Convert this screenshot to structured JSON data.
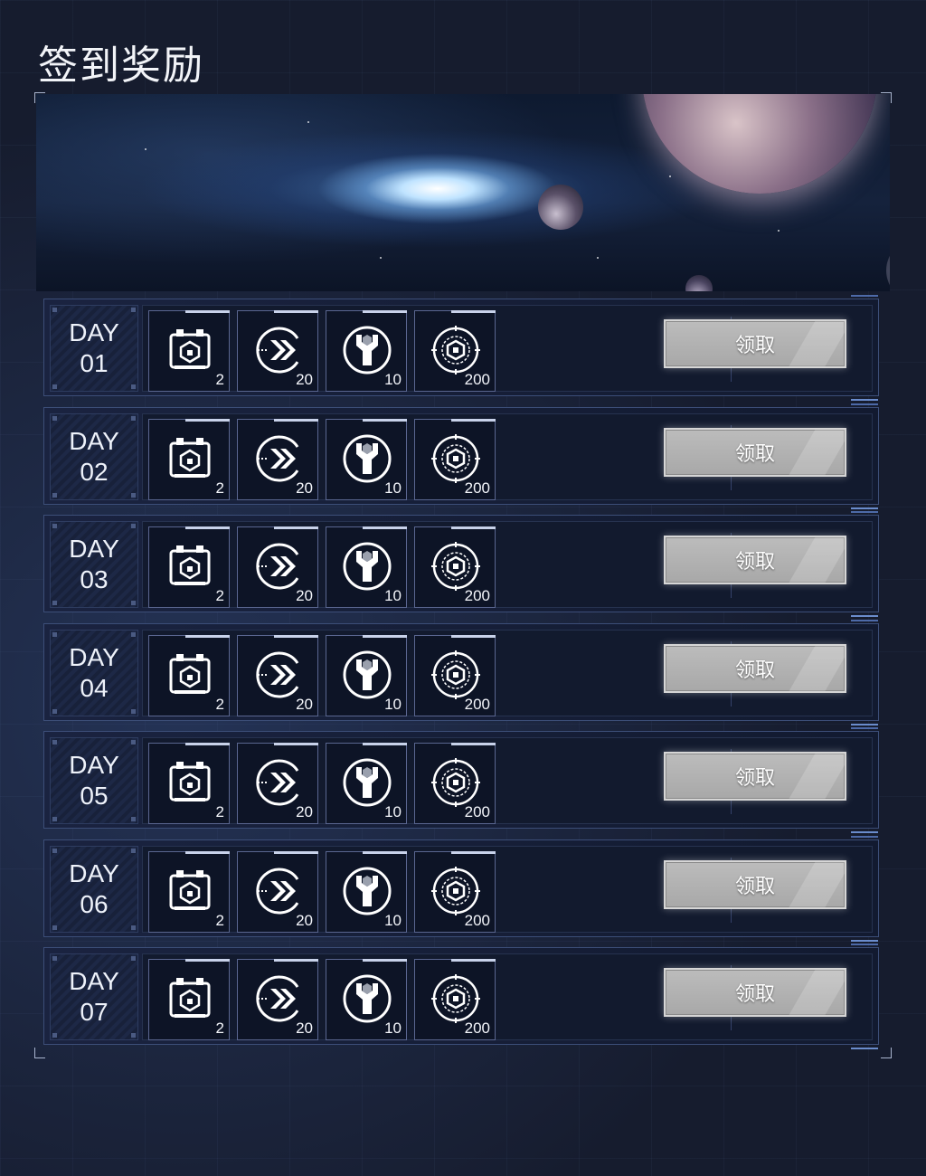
{
  "page": {
    "title": "签到奖励"
  },
  "colors": {
    "background": "#161c2e",
    "row_border": "#3c4e78",
    "button": "#b0b0b0",
    "accent": "#6a8ccc"
  },
  "rows": [
    {
      "day_label": "DAY",
      "day_num": "01",
      "items": [
        {
          "icon": "crate-icon",
          "qty": "2"
        },
        {
          "icon": "speed-arrows-icon",
          "qty": "20"
        },
        {
          "icon": "wrench-icon",
          "qty": "10"
        },
        {
          "icon": "cube-core-icon",
          "qty": "200"
        }
      ],
      "button": "领取"
    },
    {
      "day_label": "DAY",
      "day_num": "02",
      "items": [
        {
          "icon": "crate-icon",
          "qty": "2"
        },
        {
          "icon": "speed-arrows-icon",
          "qty": "20"
        },
        {
          "icon": "wrench-icon",
          "qty": "10"
        },
        {
          "icon": "cube-core-icon",
          "qty": "200"
        }
      ],
      "button": "领取"
    },
    {
      "day_label": "DAY",
      "day_num": "03",
      "items": [
        {
          "icon": "crate-icon",
          "qty": "2"
        },
        {
          "icon": "speed-arrows-icon",
          "qty": "20"
        },
        {
          "icon": "wrench-icon",
          "qty": "10"
        },
        {
          "icon": "cube-core-icon",
          "qty": "200"
        }
      ],
      "button": "领取"
    },
    {
      "day_label": "DAY",
      "day_num": "04",
      "items": [
        {
          "icon": "crate-icon",
          "qty": "2"
        },
        {
          "icon": "speed-arrows-icon",
          "qty": "20"
        },
        {
          "icon": "wrench-icon",
          "qty": "10"
        },
        {
          "icon": "cube-core-icon",
          "qty": "200"
        }
      ],
      "button": "领取"
    },
    {
      "day_label": "DAY",
      "day_num": "05",
      "items": [
        {
          "icon": "crate-icon",
          "qty": "2"
        },
        {
          "icon": "speed-arrows-icon",
          "qty": "20"
        },
        {
          "icon": "wrench-icon",
          "qty": "10"
        },
        {
          "icon": "cube-core-icon",
          "qty": "200"
        }
      ],
      "button": "领取"
    },
    {
      "day_label": "DAY",
      "day_num": "06",
      "items": [
        {
          "icon": "crate-icon",
          "qty": "2"
        },
        {
          "icon": "speed-arrows-icon",
          "qty": "20"
        },
        {
          "icon": "wrench-icon",
          "qty": "10"
        },
        {
          "icon": "cube-core-icon",
          "qty": "200"
        }
      ],
      "button": "领取"
    },
    {
      "day_label": "DAY",
      "day_num": "07",
      "items": [
        {
          "icon": "crate-icon",
          "qty": "2"
        },
        {
          "icon": "speed-arrows-icon",
          "qty": "20"
        },
        {
          "icon": "wrench-icon",
          "qty": "10"
        },
        {
          "icon": "cube-core-icon",
          "qty": "200"
        }
      ],
      "button": "领取"
    }
  ]
}
